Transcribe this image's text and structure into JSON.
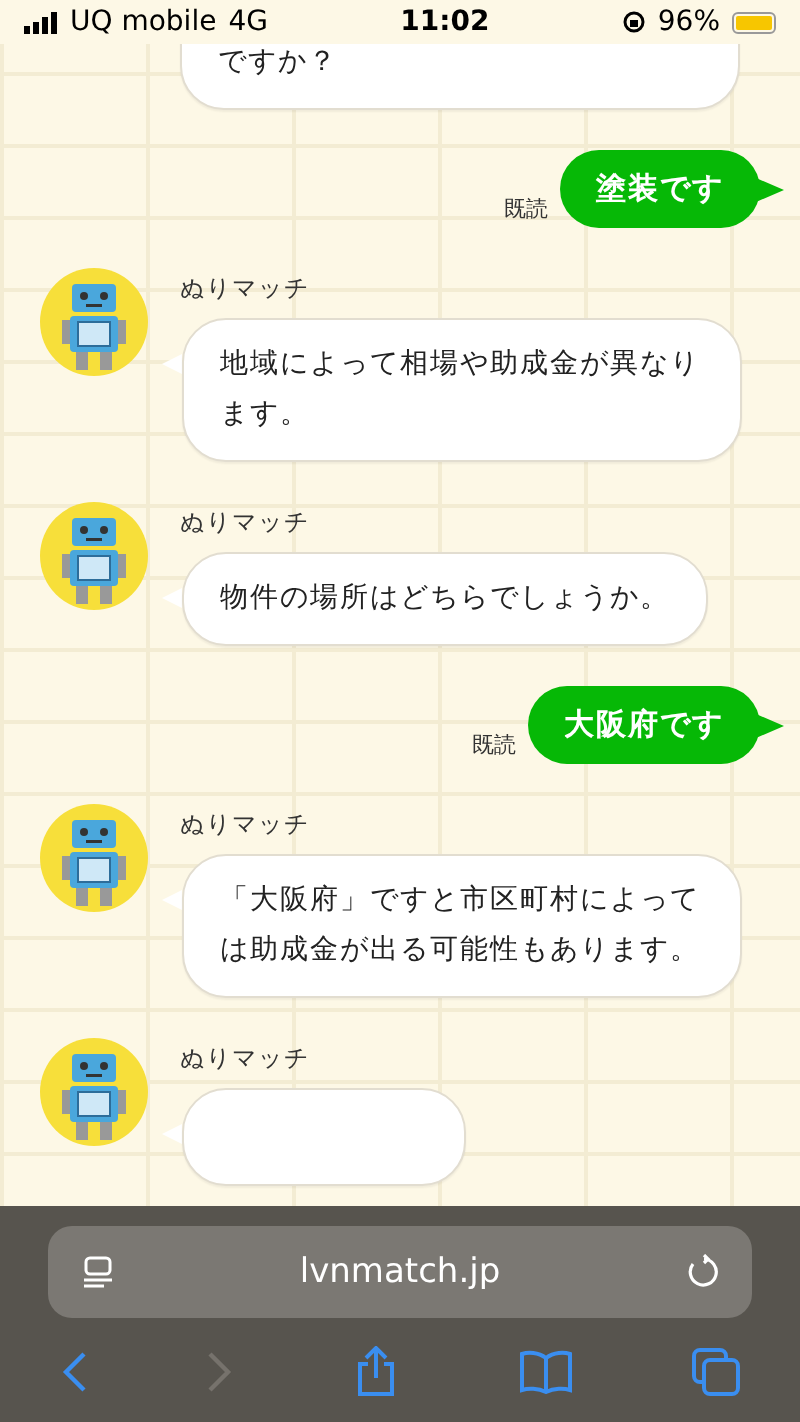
{
  "status_bar": {
    "carrier": "UQ mobile",
    "network": "4G",
    "time": "11:02",
    "battery": "96%"
  },
  "messages": [
    {
      "kind": "cut",
      "text": "ですか？"
    },
    {
      "kind": "user",
      "text": "塗装です",
      "read": "既読"
    },
    {
      "kind": "bot",
      "sender": "ぬりマッチ",
      "text": "地域によって相場や助成金が異なります。"
    },
    {
      "kind": "bot",
      "sender": "ぬりマッチ",
      "text": "物件の場所はどちらでしょうか。"
    },
    {
      "kind": "user",
      "text": "大阪府です",
      "read": "既読"
    },
    {
      "kind": "bot",
      "sender": "ぬりマッチ",
      "text": "「大阪府」ですと市区町村によっては助成金が出る可能性もあります。"
    },
    {
      "kind": "bot",
      "sender": "ぬりマッチ"
    }
  ],
  "browser": {
    "url": "lvnmatch.jp",
    "forward_disabled": true
  }
}
